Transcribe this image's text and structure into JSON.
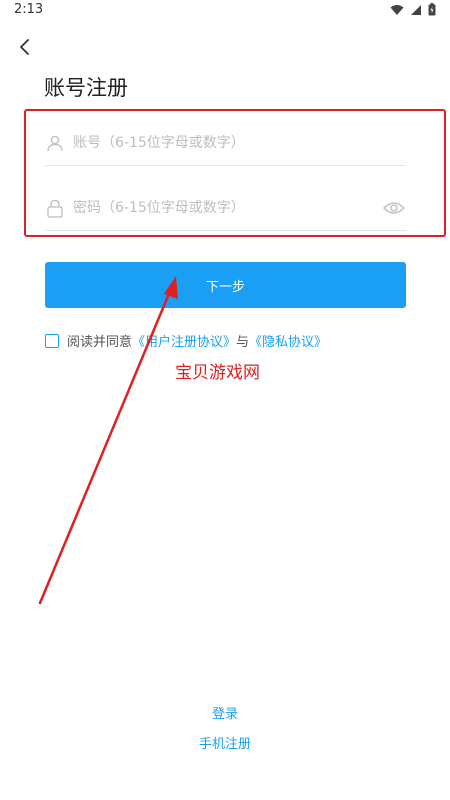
{
  "status_bar": {
    "time": "2:13"
  },
  "header": {
    "title": "账号注册"
  },
  "form": {
    "account": {
      "value": "",
      "placeholder": "账号（6-15位字母或数字）"
    },
    "password": {
      "value": "",
      "placeholder": "密码（6-15位字母或数字）"
    }
  },
  "next_button": {
    "label": "下一步"
  },
  "agreement": {
    "prefix": "阅读并同意",
    "user_agreement": "《用户注册协议》",
    "conjunction": "与",
    "privacy_agreement": "《隐私协议》",
    "checked": false
  },
  "watermark": "宝贝游戏网",
  "footer": {
    "login": "登录",
    "phone_register": "手机注册"
  },
  "colors": {
    "accent": "#1a9ff5",
    "annotation": "#e02020"
  }
}
